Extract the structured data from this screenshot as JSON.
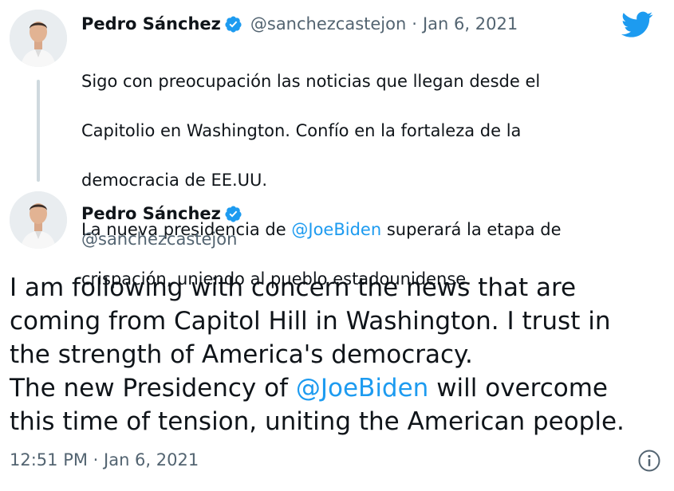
{
  "quoted_tweet": {
    "author_name": "Pedro Sánchez",
    "handle": "@sanchezcastejon",
    "separator": "·",
    "date": "Jan 6, 2021",
    "text_lines": [
      "Sigo con preocupación las noticias que llegan desde el",
      "Capitolio en Washington. Confío en la fortaleza de la",
      "democracia de EE.UU."
    ],
    "line4_before": "La nueva presidencia de ",
    "line4_mention": "@JoeBiden",
    "line4_after": " superará la etapa de",
    "line5": "crispación, uniendo al pueblo estadounidense."
  },
  "main_tweet": {
    "author_name": "Pedro Sánchez",
    "handle": "@sanchezcastejon",
    "text_lines": [
      "I am following with concern the news that are",
      "coming from Capitol Hill in Washington. I trust in",
      "the strength of America's democracy."
    ],
    "line4_before": "The new Presidency of ",
    "line4_mention": "@JoeBiden",
    "line4_after": " will overcome",
    "line5": "this time of tension, uniting the American people.",
    "timestamp": "12:51 PM · Jan 6, 2021"
  },
  "icons": {
    "logo": "twitter-bird-icon",
    "verified": "verified-badge-icon",
    "info": "info-icon"
  },
  "colors": {
    "brand": "#1d9bf0",
    "text": "#0f1419",
    "muted": "#536471"
  }
}
